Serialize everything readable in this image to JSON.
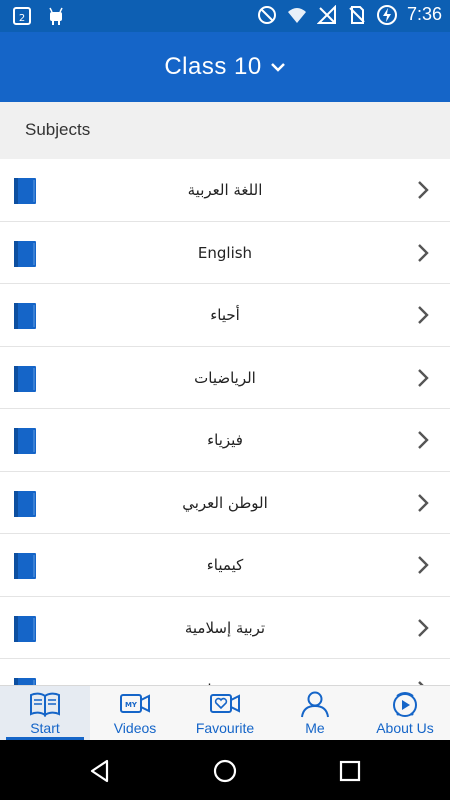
{
  "status_bar": {
    "time": "7:36",
    "left_icons": [
      "notification-icon",
      "android-debug-icon"
    ],
    "right_icons": [
      "do-not-disturb-icon",
      "wifi-icon",
      "no-signal-icon",
      "no-sim-icon",
      "battery-charging-icon"
    ]
  },
  "app_bar": {
    "title": "Class 10",
    "dropdown_icon": "chevron-down-icon",
    "color": "#1565c8"
  },
  "section": {
    "title": "Subjects"
  },
  "subjects": [
    {
      "name": "اللغة العربية"
    },
    {
      "name": "English"
    },
    {
      "name": "أحياء"
    },
    {
      "name": "الرياضيات"
    },
    {
      "name": "فيزياء"
    },
    {
      "name": "الوطن العربي"
    },
    {
      "name": "كيمياء"
    },
    {
      "name": "تربية إسلامية"
    },
    {
      "name": "تربية وطنية"
    }
  ],
  "tabs": [
    {
      "label": "Start",
      "icon": "book-open-icon",
      "active": true
    },
    {
      "label": "Videos",
      "icon": "my-videos-icon",
      "active": false
    },
    {
      "label": "Favourite",
      "icon": "favourite-video-icon",
      "active": false
    },
    {
      "label": "Me",
      "icon": "person-icon",
      "active": false
    },
    {
      "label": "About Us",
      "icon": "about-icon",
      "active": false
    }
  ],
  "nav_bar": {
    "buttons": [
      "back-icon",
      "home-icon",
      "recents-icon"
    ]
  }
}
